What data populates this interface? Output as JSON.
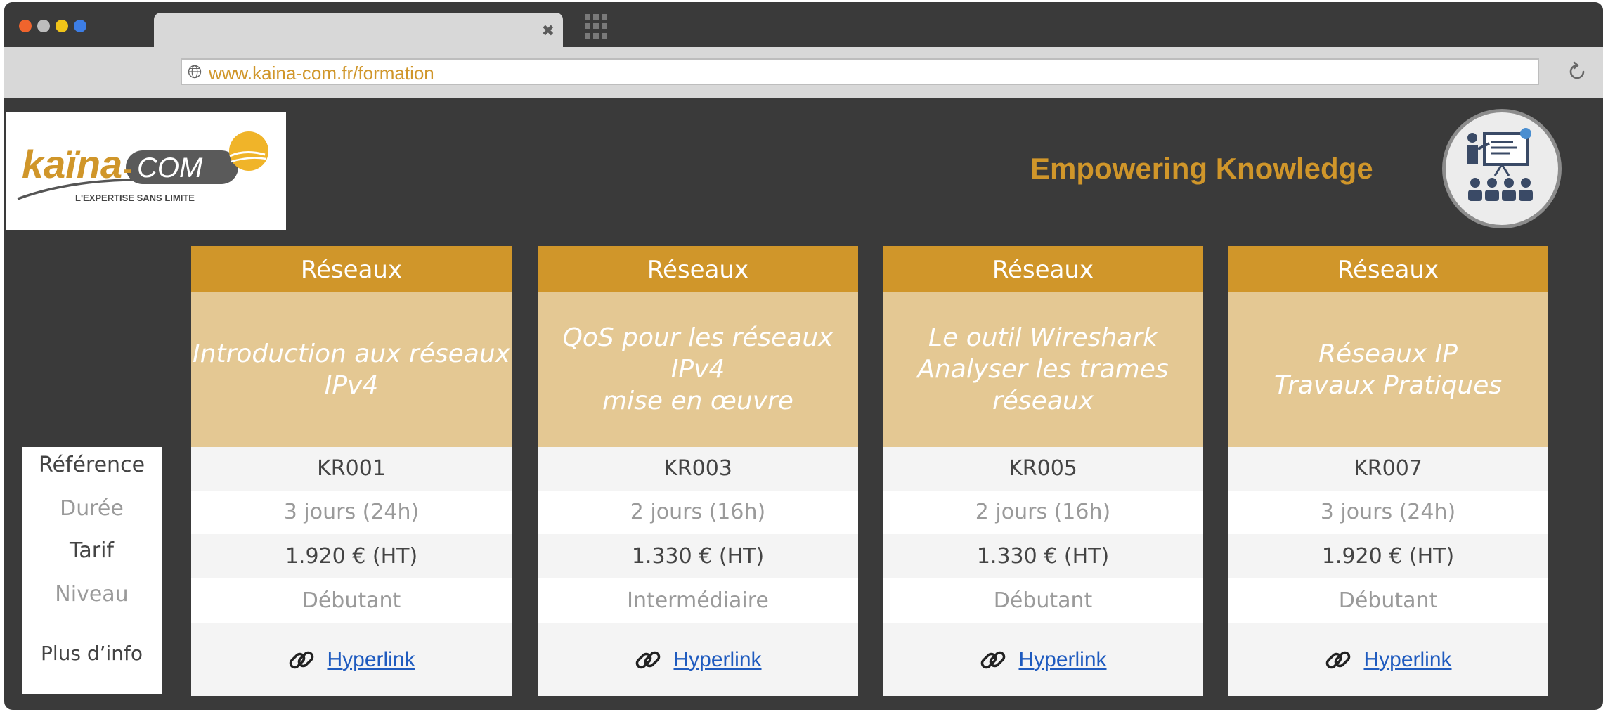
{
  "browser": {
    "url": "www.kaina-com.fr/formation",
    "window_dots": [
      "#f0642d",
      "#bdbdbd",
      "#f0c419",
      "#3d7ee6"
    ]
  },
  "logo": {
    "brand_left": "kaïna",
    "brand_right": "COM",
    "tagline_small": "L'EXPERTISE SANS LIMITE"
  },
  "header": {
    "tagline": "Empowering Knowledge"
  },
  "row_labels": [
    "Référence",
    "Durée",
    "Tarif",
    "Niveau",
    "Plus d’info"
  ],
  "courses": [
    {
      "category": "Réseaux",
      "title": "Introduction aux réseaux\nIPv4",
      "reference": "KR001",
      "duration": "3 jours (24h)",
      "price": "1.920 € (HT)",
      "level": "Débutant",
      "link": "Hyperlink"
    },
    {
      "category": "Réseaux",
      "title": "QoS pour les réseaux IPv4\nmise en œuvre",
      "reference": "KR003",
      "duration": "2 jours (16h)",
      "price": "1.330 € (HT)",
      "level": "Intermédiaire",
      "link": "Hyperlink"
    },
    {
      "category": "Réseaux",
      "title": "Le outil Wireshark\nAnalyser les trames\nréseaux",
      "reference": "KR005",
      "duration": "2 jours (16h)",
      "price": "1.330 € (HT)",
      "level": "Débutant",
      "link": "Hyperlink"
    },
    {
      "category": "Réseaux",
      "title": "Réseaux IP\nTravaux Pratiques",
      "reference": "KR007",
      "duration": "3 jours (24h)",
      "price": "1.920 € (HT)",
      "level": "Débutant",
      "link": "Hyperlink"
    }
  ],
  "colors": {
    "accent": "#d0962a",
    "title_band": "#e4c893",
    "frame": "#3a3a3a",
    "link": "#1f5bbf"
  }
}
